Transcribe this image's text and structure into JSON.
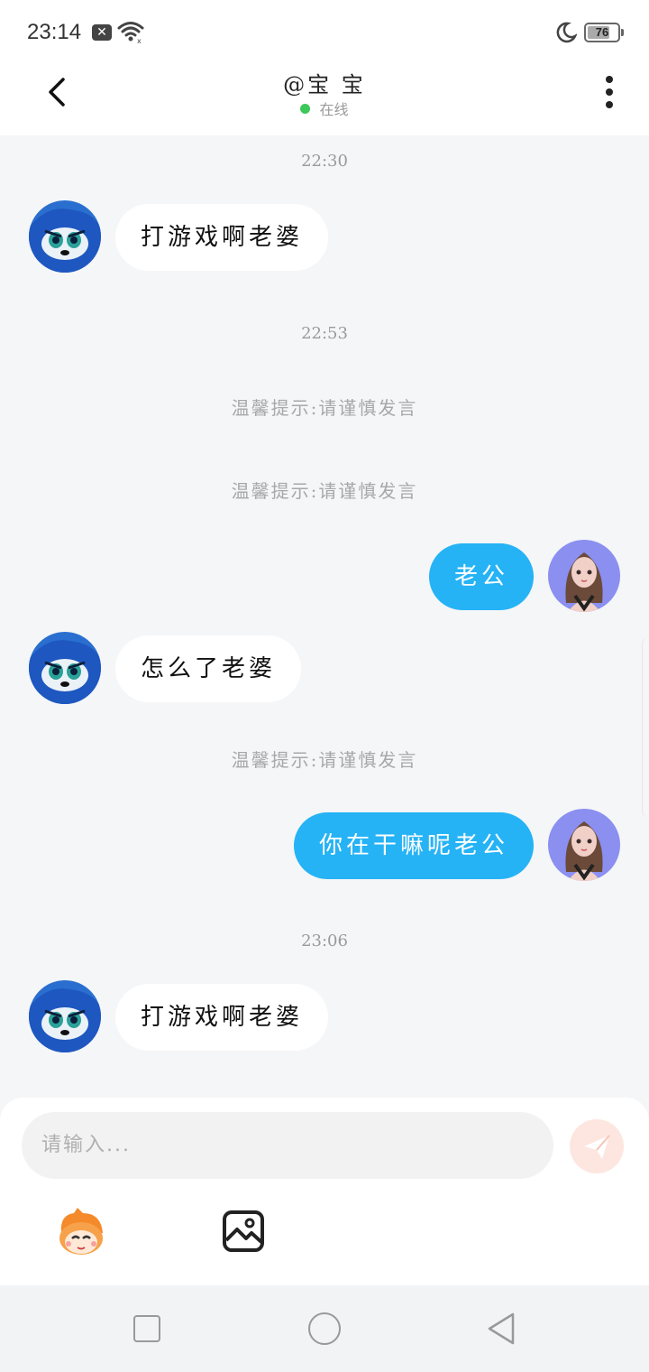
{
  "status_bar": {
    "time": "23:14",
    "battery": "76",
    "battery_level": 0.76,
    "icons": [
      "notification-x-icon",
      "wifi-icon",
      "moon-icon",
      "battery-icon"
    ]
  },
  "header": {
    "title": "@宝 宝",
    "status": "在线",
    "status_color": "#3cc85a",
    "icons": [
      "back-arrow-icon",
      "more-vertical-icon"
    ]
  },
  "chat": {
    "timestamps": [
      "22:30",
      "22:53",
      "23:06"
    ],
    "tips": [
      "温馨提示:请谨慎发言",
      "温馨提示:请谨慎发言",
      "温馨提示:请谨慎发言"
    ],
    "messages": [
      {
        "side": "left",
        "text": "打游戏啊老婆"
      },
      {
        "side": "right",
        "text": "老公"
      },
      {
        "side": "left",
        "text": "怎么了老婆"
      },
      {
        "side": "right",
        "text": "你在干嘛呢老公"
      },
      {
        "side": "left",
        "text": "打游戏啊老婆"
      }
    ]
  },
  "input": {
    "placeholder": "请输入...",
    "icons": [
      "send-icon",
      "emoji-icon",
      "image-icon"
    ]
  },
  "navbar": {
    "icons": [
      "recent-apps-icon",
      "home-icon",
      "back-icon"
    ]
  },
  "colors": {
    "accent": "#25b3f5",
    "background": "#f5f6f8",
    "send_button": "#fde6df"
  }
}
